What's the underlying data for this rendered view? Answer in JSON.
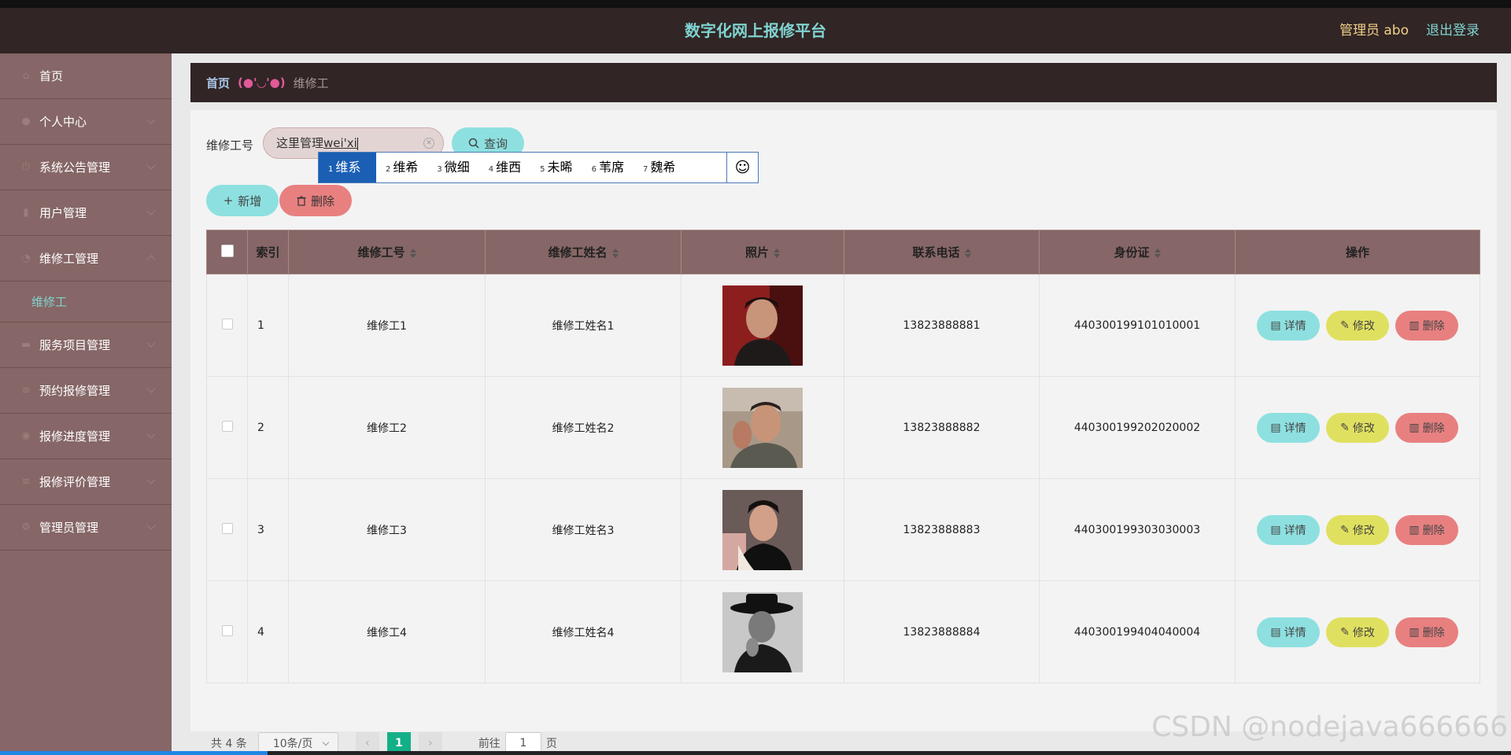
{
  "header": {
    "title": "数字化网上报修平台",
    "user": "管理员 abo",
    "logout": "退出登录"
  },
  "sidebar": {
    "items": [
      {
        "label": "首页",
        "icon": "home-icon"
      },
      {
        "label": "个人中心",
        "icon": "user-icon"
      },
      {
        "label": "系统公告管理",
        "icon": "power-icon"
      },
      {
        "label": "用户管理",
        "icon": "trash-icon"
      },
      {
        "label": "维修工管理",
        "icon": "clock-icon",
        "expanded": true,
        "sub": "维修工"
      },
      {
        "label": "服务项目管理",
        "icon": "message-icon"
      },
      {
        "label": "预约报修管理",
        "icon": "menu-icon"
      },
      {
        "label": "报修进度管理",
        "icon": "location-icon"
      },
      {
        "label": "报修评价管理",
        "icon": "menu-icon"
      },
      {
        "label": "管理员管理",
        "icon": "gear-icon"
      }
    ]
  },
  "breadcrumb": {
    "home": "首页",
    "separator": "(●'◡'●)",
    "current": "维修工"
  },
  "search": {
    "label": "维修工号",
    "value_prefix": "这里管理",
    "value_typed": "wei'xi",
    "button": "查询"
  },
  "ime": {
    "candidates": [
      {
        "n": "1",
        "text": "维系"
      },
      {
        "n": "2",
        "text": "维希"
      },
      {
        "n": "3",
        "text": "微细"
      },
      {
        "n": "4",
        "text": "维西"
      },
      {
        "n": "5",
        "text": "未晞"
      },
      {
        "n": "6",
        "text": "苇席"
      },
      {
        "n": "7",
        "text": "魏希"
      }
    ],
    "emoji": "☺"
  },
  "toolbar": {
    "add": "新增",
    "delete": "删除"
  },
  "table": {
    "columns": [
      "索引",
      "维修工号",
      "维修工姓名",
      "照片",
      "联系电话",
      "身份证",
      "操作"
    ],
    "rows": [
      {
        "index": "1",
        "no": "维修工1",
        "name": "维修工姓名1",
        "phone": "13823888881",
        "id": "440300199101010001"
      },
      {
        "index": "2",
        "no": "维修工2",
        "name": "维修工姓名2",
        "phone": "13823888882",
        "id": "440300199202020002"
      },
      {
        "index": "3",
        "no": "维修工3",
        "name": "维修工姓名3",
        "phone": "13823888883",
        "id": "440300199303030003"
      },
      {
        "index": "4",
        "no": "维修工4",
        "name": "维修工姓名4",
        "phone": "13823888884",
        "id": "440300199404040004"
      }
    ],
    "actions": {
      "detail": "详情",
      "edit": "修改",
      "remove": "删除"
    }
  },
  "pager": {
    "total": "共 4 条",
    "size": "10条/页",
    "page": "1",
    "goto": "前往",
    "goto_value": "1",
    "unit": "页"
  },
  "watermark": "CSDN @nodejava666666",
  "colors": {
    "accent": "#7fd3d0",
    "sidebar": "#866666",
    "header": "#312525",
    "primary_page": "#13b088"
  }
}
